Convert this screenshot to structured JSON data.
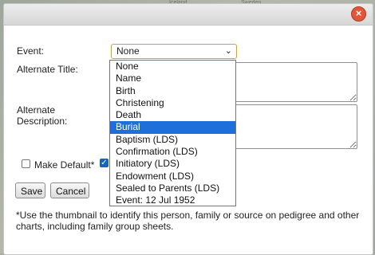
{
  "background": {
    "map_labels": [
      "Iceland",
      "Sweden"
    ]
  },
  "dialog": {
    "close_icon": "close-icon",
    "event_label": "Event:",
    "event_selected": "None",
    "alternate_title_label": "Alternate Title:",
    "alternate_description_label": [
      "Alternate",
      "Description:"
    ],
    "make_default_label": "Make Default*",
    "event_options": [
      "None",
      "Name",
      "Birth",
      "Christening",
      "Death",
      "Burial",
      "Baptism (LDS)",
      "Confirmation (LDS)",
      "Initiatory (LDS)",
      "Endowment (LDS)",
      "Sealed to Parents (LDS)",
      "Event: 12 Jul 1952"
    ],
    "highlighted_option": "Burial",
    "save_label": "Save",
    "cancel_label": "Cancel",
    "note": "*Use the thumbnail to identify this person, family or source on pedigree and other charts, including family group sheets.",
    "colors": {
      "close": "#e0563a",
      "select_border": "#e0a400",
      "highlight": "#1e6fd9"
    }
  }
}
